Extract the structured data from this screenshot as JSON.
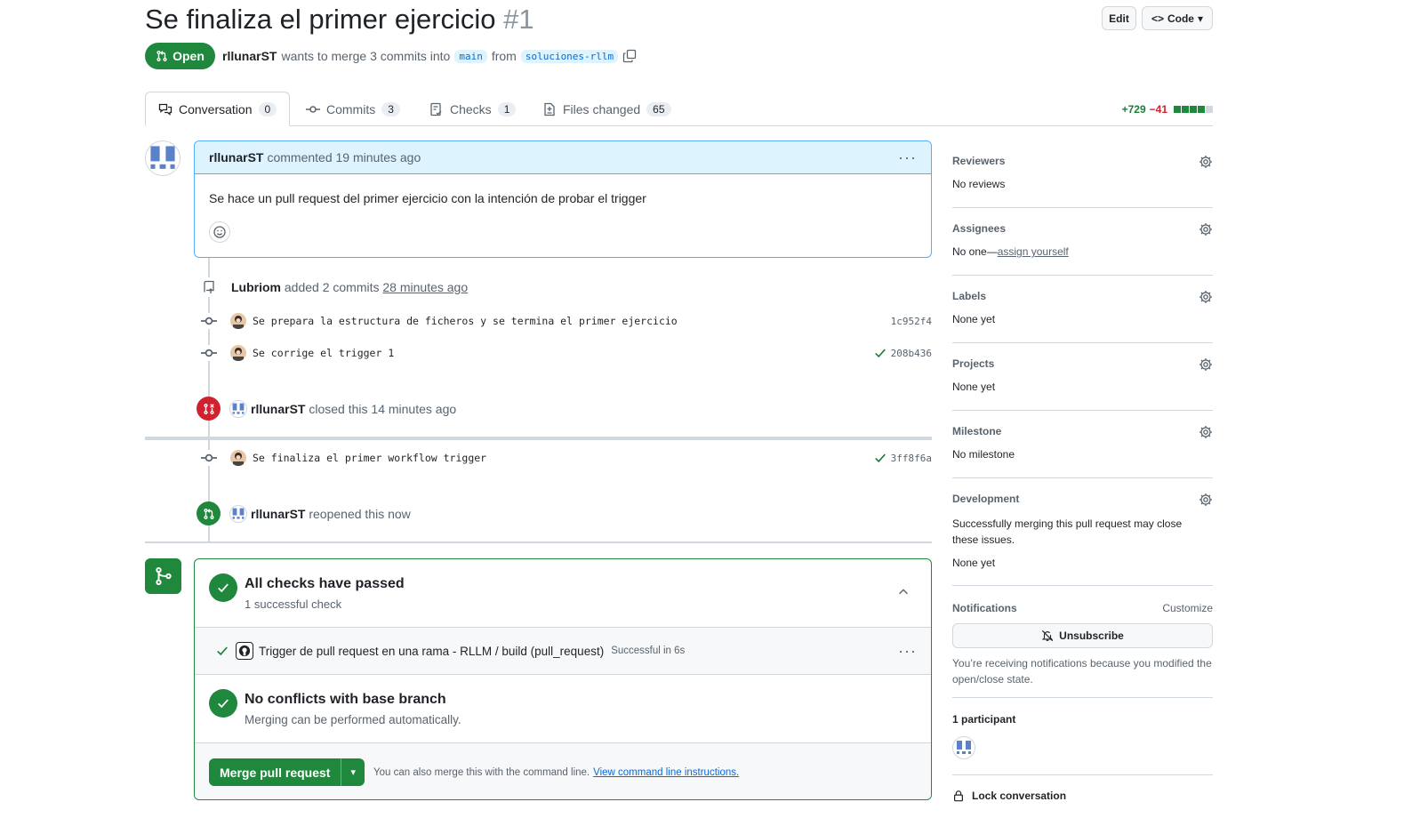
{
  "header": {
    "title": "Se finaliza el primer ejercicio",
    "number": "#1",
    "edit_label": "Edit",
    "code_label": "Code",
    "state": "Open",
    "author": "rllunarST",
    "merge_text": "wants to merge 3 commits into",
    "base_branch": "main",
    "from_text": "from",
    "head_branch": "soluciones-rllm"
  },
  "tabs": [
    {
      "label": "Conversation",
      "count": "0"
    },
    {
      "label": "Commits",
      "count": "3"
    },
    {
      "label": "Checks",
      "count": "1"
    },
    {
      "label": "Files changed",
      "count": "65"
    }
  ],
  "diffstat": {
    "additions": "+729",
    "deletions": "−41"
  },
  "comment": {
    "author": "rllunarST",
    "action": "commented",
    "time": "19 minutes ago",
    "body": "Se hace un pull request del primer ejercicio con la intención de probar el trigger"
  },
  "timeline": {
    "added": {
      "author": "Lubriom",
      "text": "added 2 commits",
      "time": "28 minutes ago"
    },
    "commits1": [
      {
        "message": "Se prepara la estructura de ficheros y se termina el primer ejercicio",
        "sha": "1c952f4",
        "check": false
      },
      {
        "message": "Se corrige el trigger 1",
        "sha": "208b436",
        "check": true
      }
    ],
    "closed": {
      "author": "rllunarST",
      "text": "closed this",
      "time": "14 minutes ago"
    },
    "commit2": {
      "message": "Se finaliza el primer workflow trigger",
      "sha": "3ff8f6a",
      "check": true
    },
    "reopened": {
      "author": "rllunarST",
      "text": "reopened this",
      "time": "now"
    }
  },
  "merge": {
    "checks_title": "All checks have passed",
    "checks_sub": "1 successful check",
    "check_name": "Trigger de pull request en una rama - RLLM / build (pull_request)",
    "check_status": "Successful in 6s",
    "conflicts_title": "No conflicts with base branch",
    "conflicts_sub": "Merging can be performed automatically.",
    "merge_button": "Merge pull request",
    "cli_text": "You can also merge this with the command line.",
    "cli_link": "View command line instructions."
  },
  "sidebar": {
    "reviewers": {
      "label": "Reviewers",
      "value": "No reviews"
    },
    "assignees": {
      "label": "Assignees",
      "value": "No one—",
      "link": "assign yourself"
    },
    "labels": {
      "label": "Labels",
      "value": "None yet"
    },
    "projects": {
      "label": "Projects",
      "value": "None yet"
    },
    "milestone": {
      "label": "Milestone",
      "value": "No milestone"
    },
    "development": {
      "label": "Development",
      "desc": "Successfully merging this pull request may close these issues.",
      "value": "None yet"
    },
    "notifications": {
      "label": "Notifications",
      "customize": "Customize",
      "button": "Unsubscribe",
      "desc": "You’re receiving notifications because you modified the open/close state."
    },
    "participants": {
      "label": "1 participant"
    },
    "lock": {
      "label": "Lock conversation"
    }
  },
  "colors": {
    "green": "#1f883d",
    "red": "#cf222e",
    "blue": "#0969da",
    "comment_bg": "#ddf4ff"
  }
}
